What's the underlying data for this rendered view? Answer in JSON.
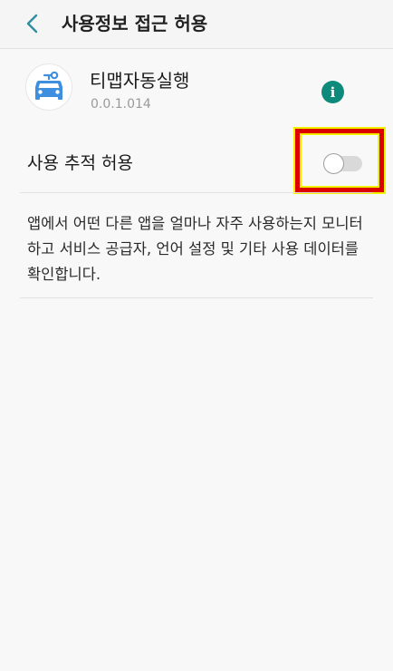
{
  "header": {
    "title": "사용정보 접근 허용"
  },
  "app": {
    "name": "티맵자동실행",
    "version": "0.0.1.014",
    "info_icon_glyph": "i"
  },
  "usage_tracking": {
    "label": "사용 추적 허용",
    "enabled": false
  },
  "description": {
    "text": "앱에서 어떤 다른 앱을 얼마나 자주 사용하는지 모니터하고 서비스 공급자, 언어 설정 및 기타 사용 데이터를 확인합니다."
  },
  "colors": {
    "accent": "#0e8a7c",
    "back_chevron": "#2f8f9d",
    "app_icon_blue": "#3f8fe0",
    "highlight_border": "#dd0000",
    "highlight_glow": "#f2f200"
  }
}
